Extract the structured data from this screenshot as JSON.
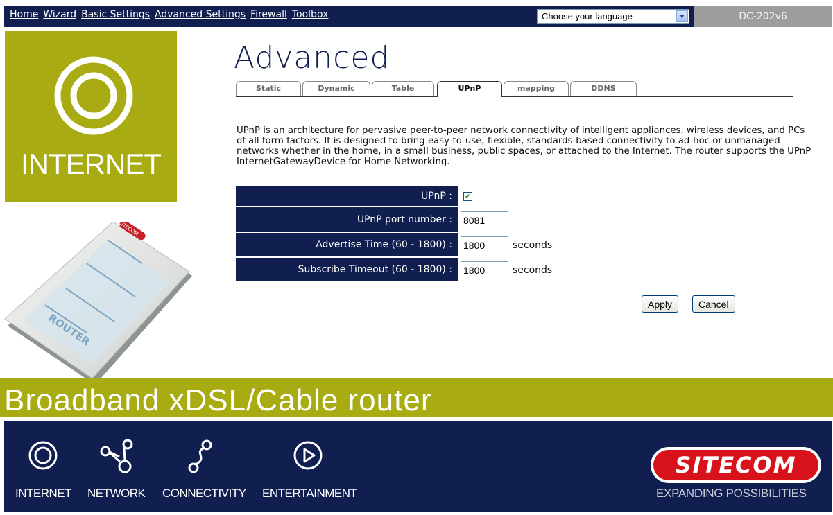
{
  "nav": {
    "links": [
      "Home",
      "Wizard",
      "Basic Settings",
      "Advanced Settings",
      "Firewall",
      "Toolbox"
    ],
    "language_select": "Choose your language",
    "model": "DC-202v6"
  },
  "left_panel": {
    "section_label": "INTERNET",
    "router_device_text": "ROUTER",
    "router_brand_text": "SITECOM"
  },
  "main": {
    "title": "Advanced",
    "tabs": [
      {
        "label": "Static"
      },
      {
        "label": "Dynamic"
      },
      {
        "label": "Table"
      },
      {
        "label": "UPnP",
        "active": true
      },
      {
        "label": "mapping"
      },
      {
        "label": "DDNS"
      }
    ],
    "description": "UPnP is an architecture for pervasive peer-to-peer network connectivity of intelligent appliances, wireless devices, and PCs of all form factors. It is designed to bring easy-to-use, flexible, standards-based connectivity to ad-hoc or unmanaged networks whether in the home, in a small business, public spaces, or attached to the Internet. The router supports the UPnP InternetGatewayDevice for Home Networking.",
    "form": {
      "upnp_label": "UPnP :",
      "upnp_checked": true,
      "port_label": "UPnP port number :",
      "port_value": "8081",
      "advertise_label": "Advertise Time (60 - 1800) :",
      "advertise_value": "1800",
      "advertise_unit": "seconds",
      "subscribe_label": "Subscribe Timeout (60 - 1800) :",
      "subscribe_value": "1800",
      "subscribe_unit": "seconds"
    },
    "apply_label": "Apply",
    "cancel_label": "Cancel"
  },
  "banner": {
    "text": "Broadband xDSL/Cable router"
  },
  "footer": {
    "items": [
      "INTERNET",
      "NETWORK",
      "CONNECTIVITY",
      "ENTERTAINMENT"
    ],
    "brand": "SITECOM",
    "tagline": "EXPANDING POSSIBILITIES"
  },
  "colors": {
    "navy": "#101f4f",
    "olive": "#a8ab12",
    "brand_red": "#d8121b",
    "model_gray": "#9d9d9d"
  }
}
